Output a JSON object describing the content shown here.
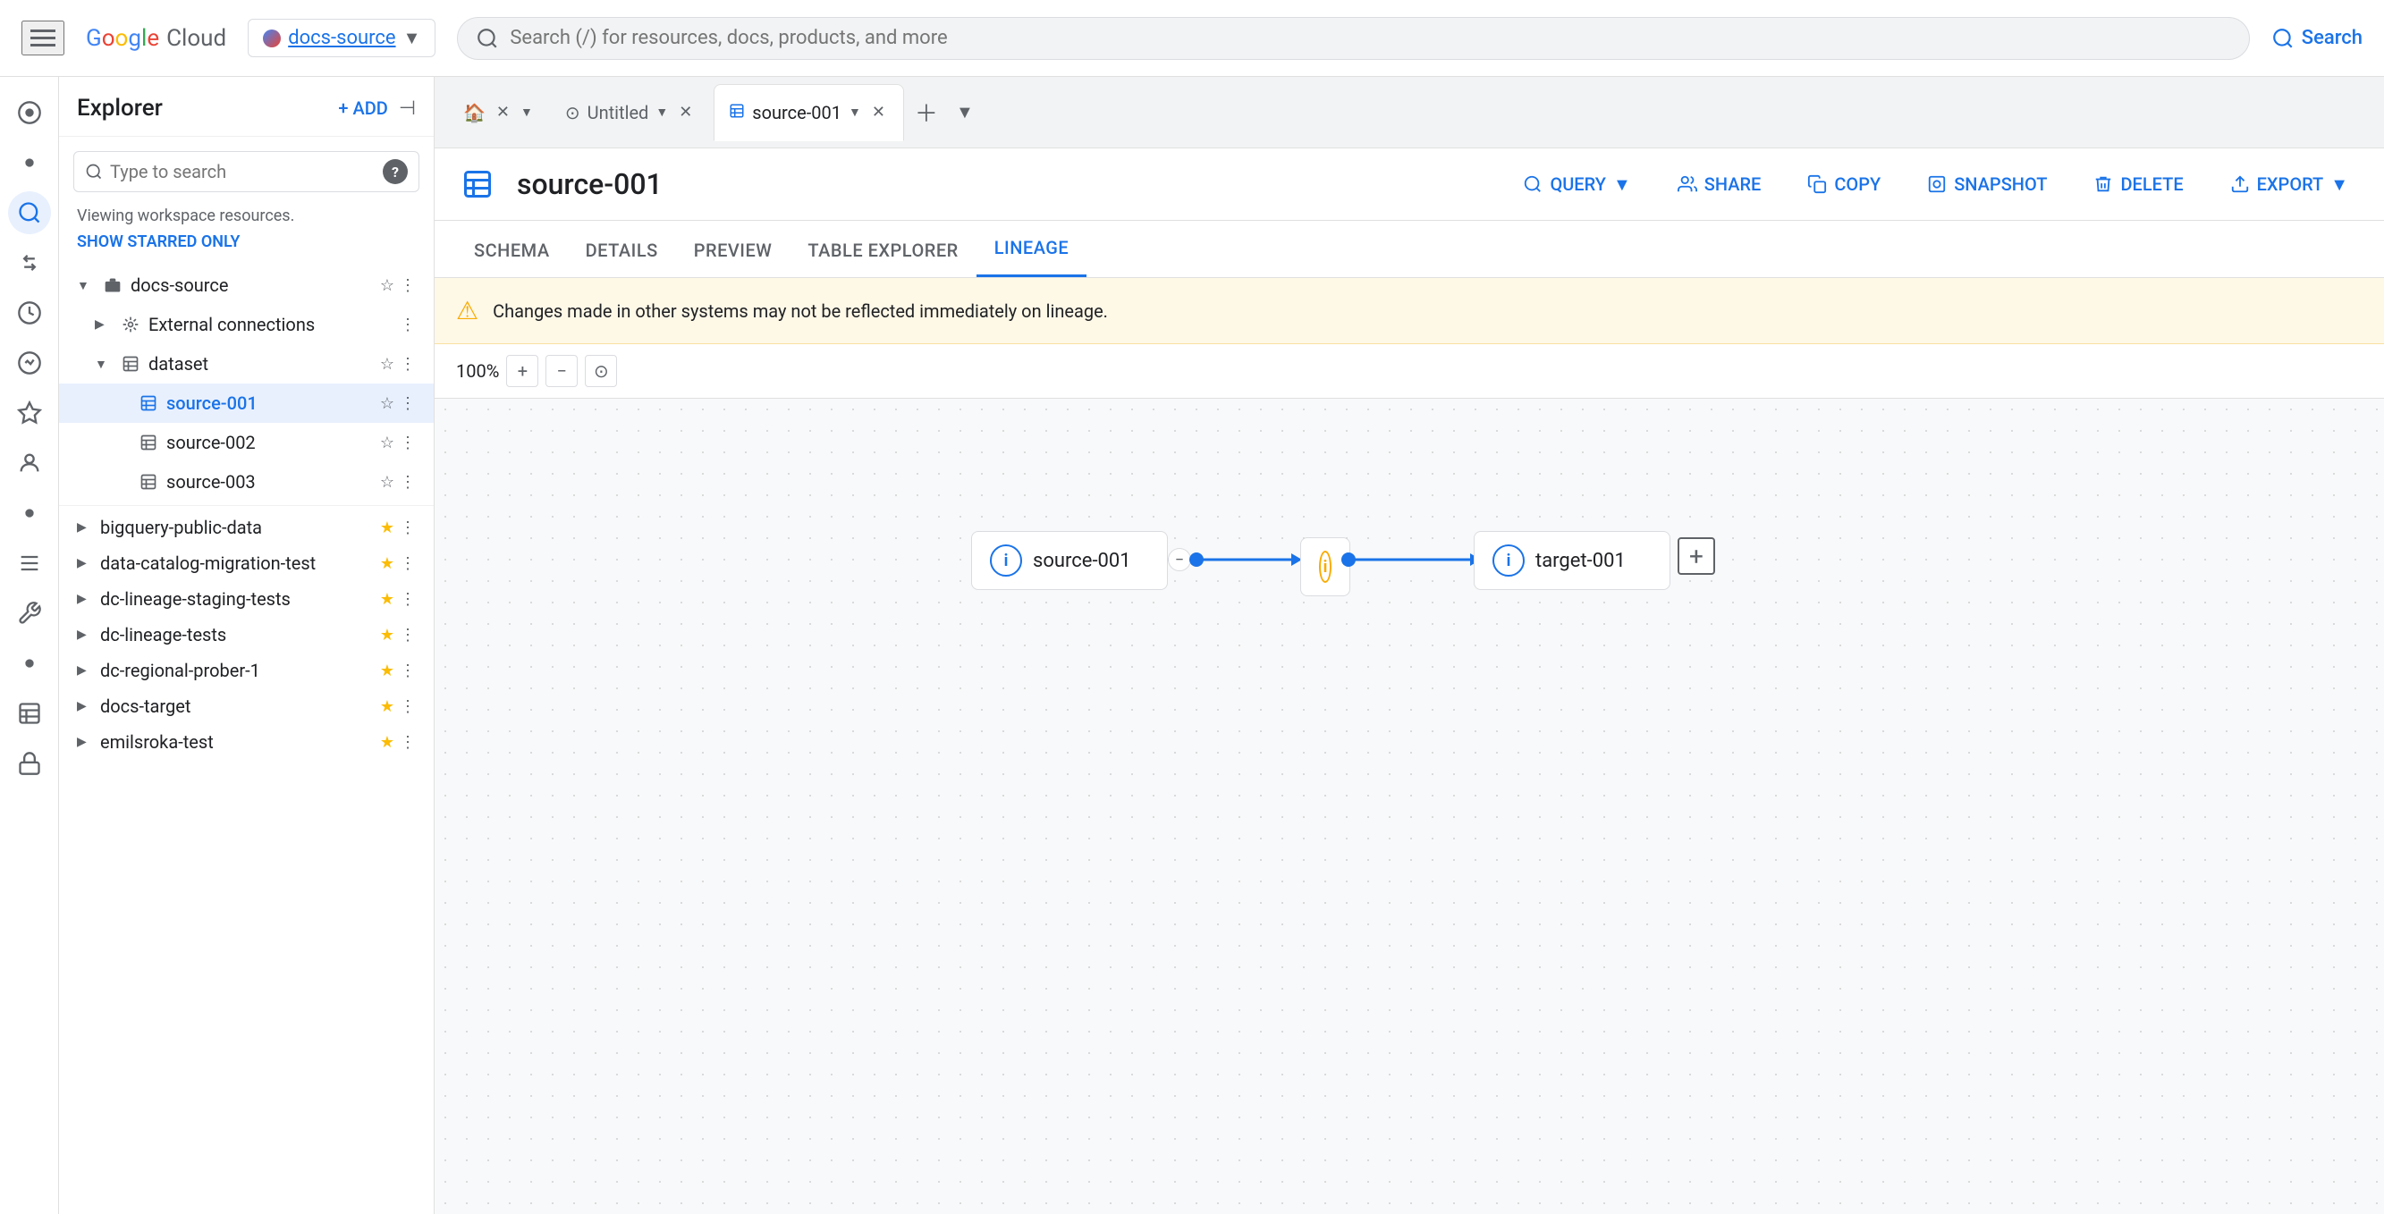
{
  "topbar": {
    "hamburger_label": "Menu",
    "logo": {
      "google": "Google",
      "cloud": " Cloud"
    },
    "project": {
      "name": "docs-source",
      "arrow": "▼"
    },
    "search": {
      "placeholder": "Search (/) for resources, docs, products, and more",
      "button_label": "Search"
    }
  },
  "explorer": {
    "title": "Explorer",
    "add_label": "+ ADD",
    "search_placeholder": "Type to search",
    "help_label": "?",
    "workspace_text": "Viewing workspace resources.",
    "show_starred": "SHOW STARRED ONLY",
    "tree": [
      {
        "id": "docs-source",
        "label": "docs-source",
        "level": 0,
        "expanded": true,
        "starred": false,
        "icon": "folder"
      },
      {
        "id": "external-connections",
        "label": "External connections",
        "level": 1,
        "expanded": false,
        "starred": false,
        "icon": "link"
      },
      {
        "id": "dataset",
        "label": "dataset",
        "level": 1,
        "expanded": true,
        "starred": false,
        "icon": "table"
      },
      {
        "id": "source-001",
        "label": "source-001",
        "level": 2,
        "expanded": false,
        "starred": false,
        "icon": "grid",
        "selected": true
      },
      {
        "id": "source-002",
        "label": "source-002",
        "level": 2,
        "expanded": false,
        "starred": false,
        "icon": "grid"
      },
      {
        "id": "source-003",
        "label": "source-003",
        "level": 2,
        "expanded": false,
        "starred": false,
        "icon": "grid"
      },
      {
        "id": "bigquery-public-data",
        "label": "bigquery-public-data",
        "level": 0,
        "expanded": false,
        "starred": true,
        "icon": "folder"
      },
      {
        "id": "data-catalog-migration-test",
        "label": "data-catalog-migration-test",
        "level": 0,
        "expanded": false,
        "starred": true,
        "icon": "folder"
      },
      {
        "id": "dc-lineage-staging-tests",
        "label": "dc-lineage-staging-tests",
        "level": 0,
        "expanded": false,
        "starred": true,
        "icon": "folder"
      },
      {
        "id": "dc-lineage-tests",
        "label": "dc-lineage-tests",
        "level": 0,
        "expanded": false,
        "starred": true,
        "icon": "folder"
      },
      {
        "id": "dc-regional-prober-1",
        "label": "dc-regional-prober-1",
        "level": 0,
        "expanded": false,
        "starred": true,
        "icon": "folder"
      },
      {
        "id": "docs-target",
        "label": "docs-target",
        "level": 0,
        "expanded": false,
        "starred": true,
        "icon": "folder"
      },
      {
        "id": "emilsroka-test",
        "label": "emilsroka-test",
        "level": 0,
        "expanded": false,
        "starred": true,
        "icon": "folder"
      }
    ]
  },
  "tabs": [
    {
      "id": "home",
      "label": "",
      "type": "home",
      "closeable": false
    },
    {
      "id": "untitled",
      "label": "Untitled",
      "type": "query",
      "closeable": true,
      "active": false
    },
    {
      "id": "source-001",
      "label": "source-001",
      "type": "table",
      "closeable": true,
      "active": true
    }
  ],
  "toolbar": {
    "table_name": "source-001",
    "query_label": "QUERY",
    "share_label": "SHARE",
    "copy_label": "COPY",
    "snapshot_label": "SNAPSHOT",
    "delete_label": "DELETE",
    "export_label": "EXPORT"
  },
  "content_tabs": [
    {
      "id": "schema",
      "label": "SCHEMA",
      "active": false
    },
    {
      "id": "details",
      "label": "DETAILS",
      "active": false
    },
    {
      "id": "preview",
      "label": "PREVIEW",
      "active": false
    },
    {
      "id": "table-explorer",
      "label": "TABLE EXPLORER",
      "active": false
    },
    {
      "id": "lineage",
      "label": "LINEAGE",
      "active": true
    }
  ],
  "warning": {
    "text": "Changes made in other systems may not be reflected immediately on lineage."
  },
  "zoom": {
    "level": "100%",
    "zoom_in": "+",
    "zoom_out": "−",
    "zoom_reset": "⊙"
  },
  "lineage": {
    "source_node": {
      "label": "source-001",
      "icon_type": "blue"
    },
    "middle_node": {
      "label": "",
      "icon_type": "orange"
    },
    "target_node": {
      "label": "target-001",
      "icon_type": "blue"
    }
  }
}
